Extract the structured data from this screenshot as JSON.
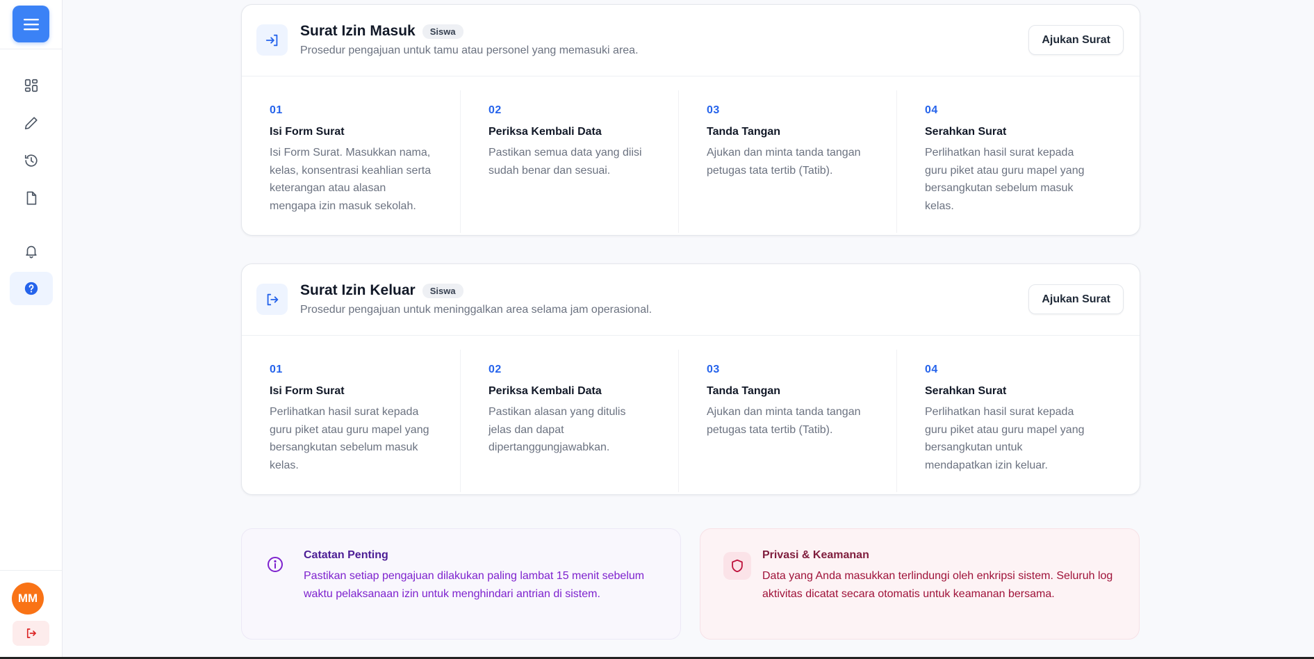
{
  "sidebar": {
    "avatar_initials": "MM",
    "items": [
      {
        "icon": "dashboard-icon"
      },
      {
        "icon": "pencil-icon"
      },
      {
        "icon": "history-icon"
      },
      {
        "icon": "document-icon"
      },
      {
        "icon": "bell-icon"
      },
      {
        "icon": "help-icon",
        "active": true
      }
    ]
  },
  "cards": [
    {
      "title": "Surat Izin Masuk",
      "badge": "Siswa",
      "subtitle": "Prosedur pengajuan untuk tamu atau personel yang memasuki area.",
      "button": "Ajukan Surat",
      "icon": "login-icon",
      "steps": [
        {
          "num": "01",
          "title": "Isi Form Surat",
          "desc": "Isi Form Surat. Masukkan nama, kelas, konsentrasi keahlian serta keterangan atau alasan mengapa izin masuk sekolah."
        },
        {
          "num": "02",
          "title": "Periksa Kembali Data",
          "desc": "Pastikan semua data yang diisi sudah benar dan sesuai."
        },
        {
          "num": "03",
          "title": "Tanda Tangan",
          "desc": "Ajukan dan minta tanda tangan petugas tata tertib (Tatib)."
        },
        {
          "num": "04",
          "title": "Serahkan Surat",
          "desc": "Perlihatkan hasil surat kepada guru piket atau guru mapel yang bersangkutan sebelum masuk kelas."
        }
      ]
    },
    {
      "title": "Surat Izin Keluar",
      "badge": "Siswa",
      "subtitle": "Prosedur pengajuan untuk meninggalkan area selama jam operasional.",
      "button": "Ajukan Surat",
      "icon": "logout-arrow-icon",
      "steps": [
        {
          "num": "01",
          "title": "Isi Form Surat",
          "desc": "Perlihatkan hasil surat kepada guru piket atau guru mapel yang bersangkutan sebelum masuk kelas."
        },
        {
          "num": "02",
          "title": "Periksa Kembali Data",
          "desc": "Pastikan alasan yang ditulis jelas dan dapat dipertanggungjawabkan."
        },
        {
          "num": "03",
          "title": "Tanda Tangan",
          "desc": "Ajukan dan minta tanda tangan petugas tata tertib (Tatib)."
        },
        {
          "num": "04",
          "title": "Serahkan Surat",
          "desc": "Perlihatkan hasil surat kepada guru piket atau guru mapel yang bersangkutan untuk mendapatkan izin keluar."
        }
      ]
    }
  ],
  "note": {
    "title": "Catatan Penting",
    "text": "Pastikan setiap pengajuan dilakukan paling lambat 15 menit sebelum waktu pelaksanaan izin untuk menghindari antrian di sistem."
  },
  "privacy": {
    "title": "Privasi & Keamanan",
    "text": "Data yang Anda masukkan terlindungi oleh enkripsi sistem. Seluruh log aktivitas dicatat secara otomatis untuk keamanan bersama."
  },
  "colors": {
    "accent": "#3b82f6",
    "step_number": "#2563eb",
    "avatar": "#f97316",
    "note_text": "#7e22ce",
    "privacy_text": "#9f1239"
  }
}
